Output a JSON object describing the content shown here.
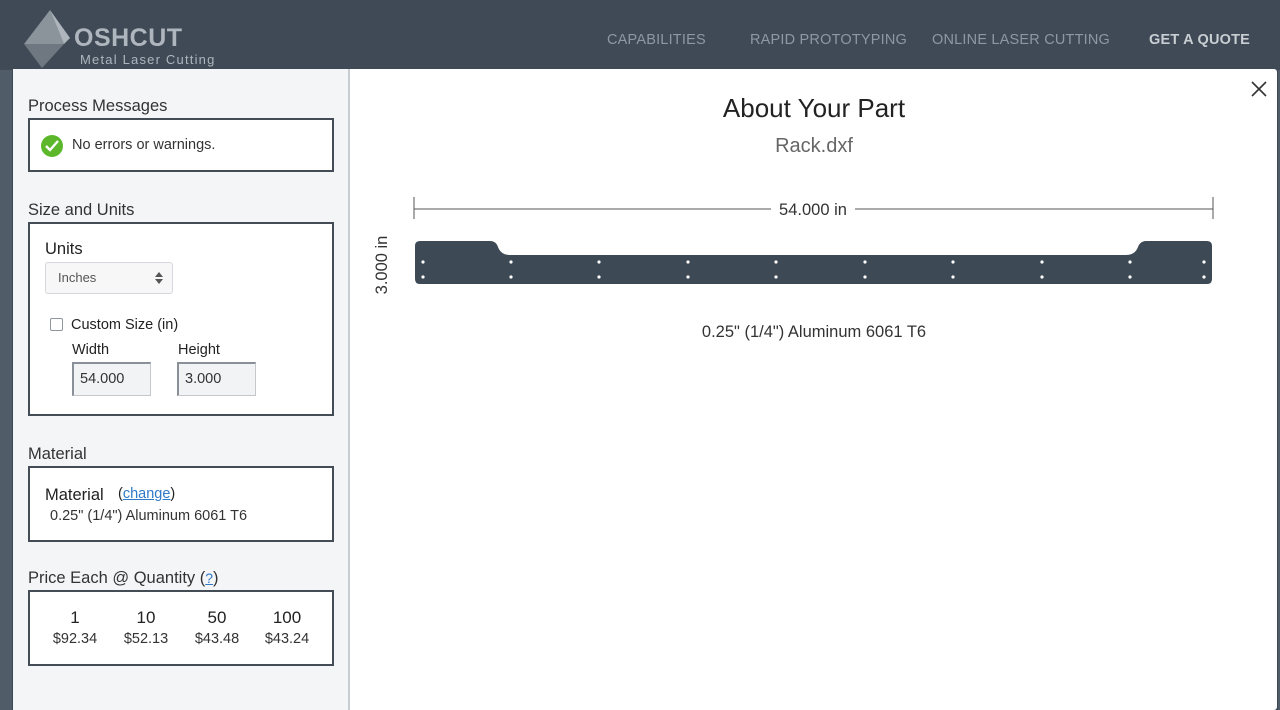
{
  "header": {
    "logo": {
      "name": "OSHCUT",
      "tagline": "Metal Laser Cutting",
      "icon": "oshcut-logo-icon"
    },
    "nav": [
      {
        "label": "CAPABILITIES"
      },
      {
        "label": "RAPID PROTOTYPING"
      },
      {
        "label": "ONLINE LASER CUTTING"
      },
      {
        "label": "GET A QUOTE"
      }
    ]
  },
  "sidebar": {
    "process": {
      "title": "Process Messages",
      "message": "No errors or warnings.",
      "status_icon": "check-circle-icon",
      "status_color": "#5cb82a"
    },
    "size": {
      "title": "Size and Units",
      "units_label": "Units",
      "units_value": "Inches",
      "custom_size_label": "Custom Size (in)",
      "custom_size_checked": false,
      "width_label": "Width",
      "width_value": "54.000",
      "height_label": "Height",
      "height_value": "3.000"
    },
    "material": {
      "title": "Material",
      "label": "Material",
      "paren_open": "(",
      "change_label": "change",
      "paren_close": ")",
      "value": "0.25\" (1/4\") Aluminum 6061 T6"
    },
    "price": {
      "title": "Price Each @ Quantity",
      "help_open": "(",
      "help_label": "?",
      "help_close": ")",
      "tiers": [
        {
          "qty": "1",
          "price": "$92.34"
        },
        {
          "qty": "10",
          "price": "$52.13"
        },
        {
          "qty": "50",
          "price": "$43.48"
        },
        {
          "qty": "100",
          "price": "$43.24"
        }
      ]
    }
  },
  "main": {
    "title": "About Your Part",
    "filename": "Rack.dxf",
    "width_dim": "54.000 in",
    "height_dim": "3.000 in",
    "material_caption": "0.25\" (1/4\") Aluminum 6061 T6",
    "part_color": "#3d4955",
    "close_icon": "close-icon"
  }
}
